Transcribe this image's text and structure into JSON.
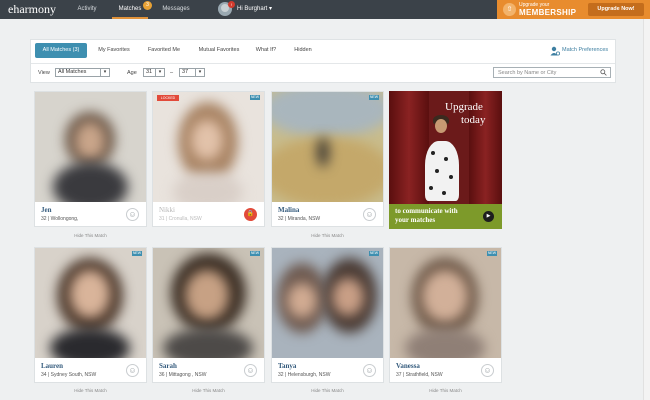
{
  "brand": {
    "logo": "eharmony"
  },
  "nav": {
    "activity": "Activity",
    "matches": "Matches",
    "matches_badge": "3",
    "messages": "Messages",
    "notif_badge": "!",
    "user_greeting": "Hi Burghart",
    "user_caret": "▾"
  },
  "upgrade_banner": {
    "line1": "Upgrade your",
    "line2": "MEMBERSHIP",
    "button": "Upgrade Now!"
  },
  "tabs": [
    {
      "label": "All Matches (3)",
      "active": true
    },
    {
      "label": "My Favorites"
    },
    {
      "label": "Favorited Me"
    },
    {
      "label": "Mutual Favorites"
    },
    {
      "label": "What If?"
    },
    {
      "label": "Hidden"
    }
  ],
  "match_preferences": "Match Preferences",
  "filters": {
    "view_label": "View",
    "view_value": "All Matches",
    "age_label": "Age",
    "age_min": "31",
    "age_dash": "–",
    "age_max": "37",
    "search_placeholder": "Search by Name or City"
  },
  "cards": [
    {
      "name": "Jen",
      "sub": "32 | Wollongong,",
      "hide": "Hide This Match"
    },
    {
      "name": "Nikki",
      "sub": "31 | Cronulla, NSW",
      "locked_tag": "LOCKED",
      "new_tag": "NEW",
      "hide": ""
    },
    {
      "name": "Malina",
      "sub": "32 | Miranda, NSW",
      "new_tag": "NEW",
      "hide": "Hide This Match"
    },
    {
      "name": "Lauren",
      "sub": "34 | Sydney South, NSW",
      "new_tag": "NEW",
      "hide": "Hide This Match"
    },
    {
      "name": "Sarah",
      "sub": "36 | Mittagong , NSW",
      "new_tag": "NEW",
      "hide": "Hide This Match"
    },
    {
      "name": "Tanya",
      "sub": "32 | Helensburgh, NSW",
      "new_tag": "NEW",
      "hide": "Hide This Match"
    },
    {
      "name": "Vanessa",
      "sub": "37 | Strathfield, NSW",
      "new_tag": "NEW",
      "hide": "Hide This Match"
    }
  ],
  "promo": {
    "title1": "Upgrade",
    "title2": "today",
    "line1": "to communicate with",
    "line2": "your matches",
    "play": "▶"
  },
  "icons": {
    "smile": "☺",
    "lock": "🔒",
    "upgrade": "⇧"
  },
  "colors": {
    "accent": "#3e8fb0",
    "brand_orange": "#e88c2e",
    "promo_green": "#7d9a2a"
  }
}
